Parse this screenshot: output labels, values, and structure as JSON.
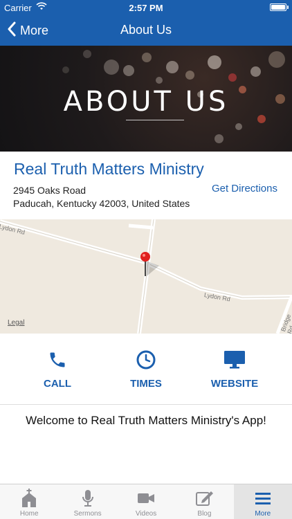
{
  "status_bar": {
    "carrier": "Carrier",
    "time": "2:57 PM"
  },
  "nav": {
    "back_label": "More",
    "title": "About Us"
  },
  "hero": {
    "headline": "ABOUT US"
  },
  "ministry": {
    "name": "Real Truth Matters Ministry",
    "address_line1": "2945 Oaks Road",
    "address_line2": "Paducah, Kentucky 42003, United States",
    "directions_label": "Get Directions"
  },
  "map": {
    "road_label_1": "Lydon Rd",
    "road_label_2": "Lydon Rd",
    "road_label_3": "Bridge Rd",
    "legal_label": "Legal"
  },
  "actions": [
    {
      "label": "CALL",
      "icon": "phone-icon"
    },
    {
      "label": "TIMES",
      "icon": "clock-icon"
    },
    {
      "label": "WEBSITE",
      "icon": "monitor-icon"
    }
  ],
  "welcome_text": "Welcome to Real Truth Matters Ministry's App!",
  "tabs": [
    {
      "label": "Home",
      "icon": "church-icon"
    },
    {
      "label": "Sermons",
      "icon": "microphone-icon"
    },
    {
      "label": "Videos",
      "icon": "video-camera-icon"
    },
    {
      "label": "Blog",
      "icon": "pencil-square-icon"
    },
    {
      "label": "More",
      "icon": "menu-icon",
      "active": true
    }
  ],
  "colors": {
    "brand": "#1b5fae",
    "tab_inactive": "#8e8e93",
    "map_bg": "#efe9df",
    "pin": "#e0201e"
  }
}
